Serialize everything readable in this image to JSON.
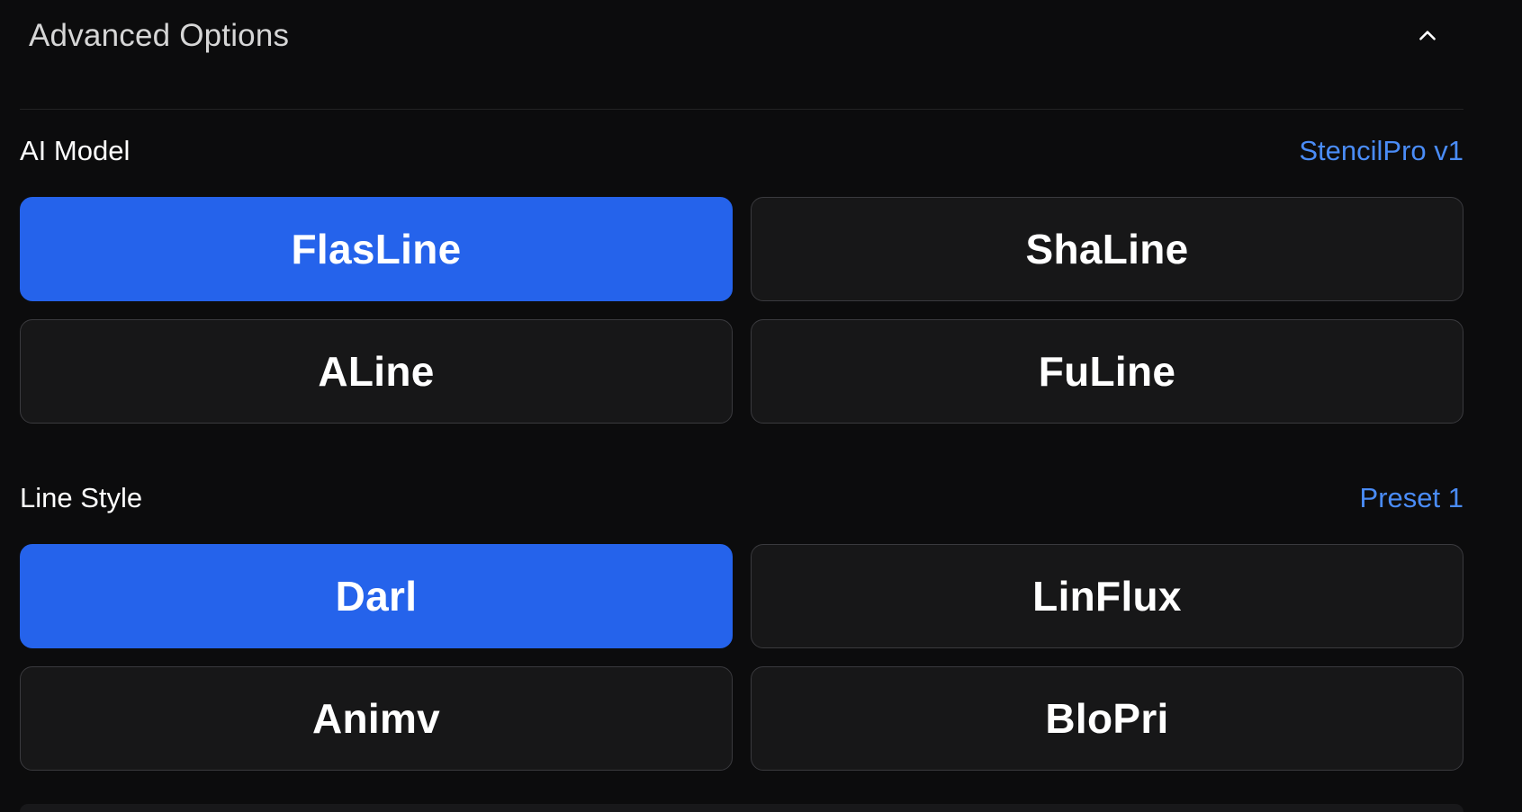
{
  "header": {
    "title": "Advanced Options",
    "collapse_icon": "chevron-up-icon"
  },
  "ai_model": {
    "label": "AI Model",
    "current": "StencilPro v1",
    "options": [
      {
        "label": "FlasLine",
        "selected": true
      },
      {
        "label": "ShaLine",
        "selected": false
      },
      {
        "label": "ALine",
        "selected": false
      },
      {
        "label": "FuLine",
        "selected": false
      }
    ]
  },
  "line_style": {
    "label": "Line Style",
    "current": "Preset 1",
    "options": [
      {
        "label": "Darl",
        "selected": true
      },
      {
        "label": "LinFlux",
        "selected": false
      },
      {
        "label": "Animv",
        "selected": false
      },
      {
        "label": "BloPri",
        "selected": false
      }
    ]
  },
  "colors": {
    "accent": "#2563eb",
    "link": "#4a8cf7",
    "background": "#0c0c0d",
    "card": "#171718"
  }
}
